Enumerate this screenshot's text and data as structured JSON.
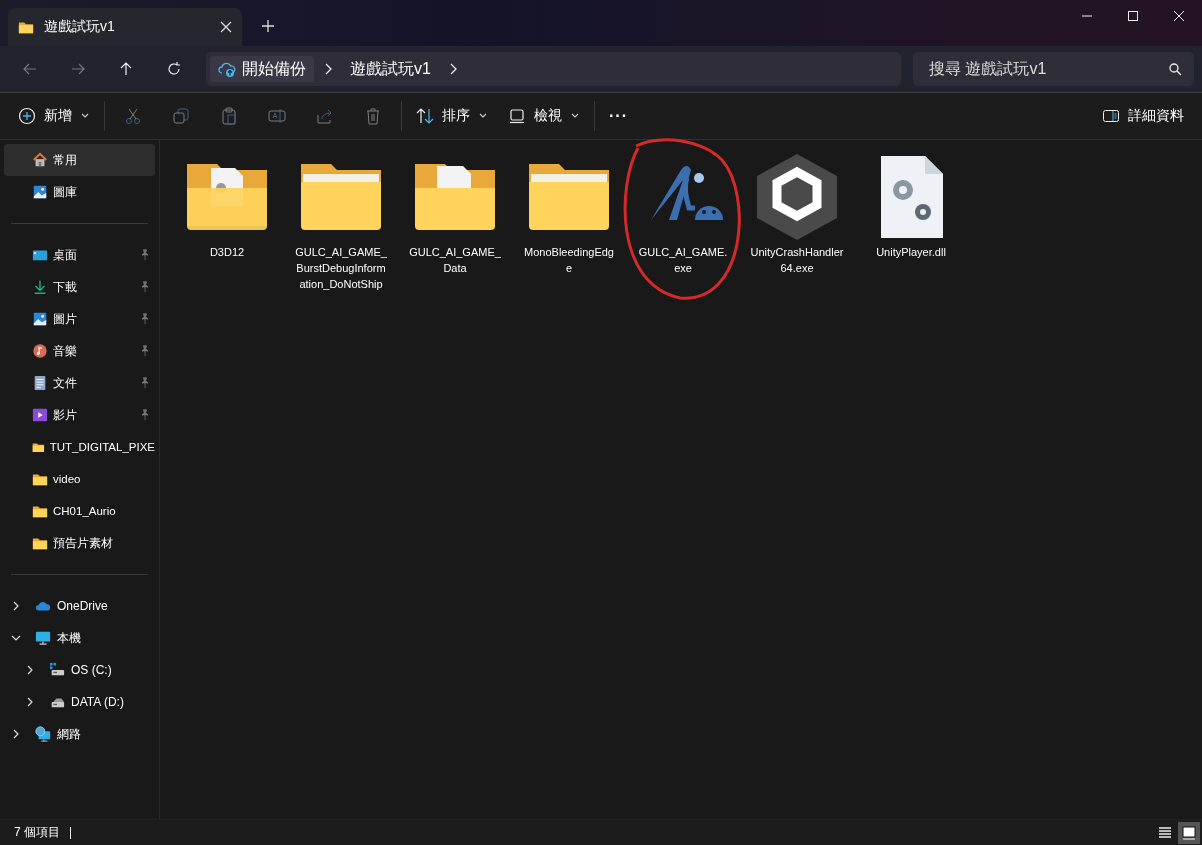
{
  "window": {
    "tab_title": "遊戲試玩v1"
  },
  "nav": {
    "breadcrumbs": [
      "開始備份",
      "遊戲試玩v1"
    ],
    "search": {
      "placeholder": "搜尋 遊戲試玩v1"
    }
  },
  "toolbar": {
    "items": [
      {
        "kind": "menu",
        "label": "新增",
        "disabled": false
      },
      {
        "kind": "icon",
        "disabled": true
      },
      {
        "kind": "icon",
        "disabled": true
      },
      {
        "kind": "icon",
        "disabled": true
      },
      {
        "kind": "icon",
        "disabled": true
      },
      {
        "kind": "icon",
        "disabled": true
      },
      {
        "kind": "icon",
        "disabled": true
      },
      {
        "kind": "menu",
        "label": "排序",
        "disabled": false
      },
      {
        "kind": "menu",
        "label": "檢視",
        "disabled": false
      },
      {
        "kind": "more",
        "label": "···",
        "disabled": false
      }
    ],
    "details": "詳細資料"
  },
  "sidebar": {
    "top": [
      {
        "label": "常用",
        "selected": true
      },
      {
        "label": "圖庫",
        "selected": false
      }
    ],
    "pinned": [
      {
        "label": "桌面",
        "pinned": true
      },
      {
        "label": "下載",
        "pinned": true
      },
      {
        "label": "圖片",
        "pinned": true
      },
      {
        "label": "音樂",
        "pinned": true
      },
      {
        "label": "文件",
        "pinned": true
      },
      {
        "label": "影片",
        "pinned": true
      },
      {
        "label": "TUT_DIGITAL_PIXE",
        "pinned": false
      },
      {
        "label": "video",
        "pinned": false
      },
      {
        "label": "CH01_Aurio",
        "pinned": false
      },
      {
        "label": "預告片素材",
        "pinned": false
      }
    ],
    "tree": [
      {
        "label": "OneDrive",
        "expanded": false
      },
      {
        "label": "本機",
        "expanded": true,
        "children": [
          {
            "label": "OS (C:)",
            "expanded": false
          },
          {
            "label": "DATA (D:)",
            "expanded": false
          }
        ]
      },
      {
        "label": "網路",
        "expanded": false
      }
    ]
  },
  "files": [
    {
      "name": "D3D12",
      "kind": "folder",
      "annotated": false
    },
    {
      "name": "GULC_AI_GAME_BurstDebugInformation_DoNotShip",
      "kind": "folder",
      "annotated": false
    },
    {
      "name": "GULC_AI_GAME_Data",
      "kind": "folder",
      "annotated": false
    },
    {
      "name": "MonoBleedingEdge",
      "kind": "folder",
      "annotated": false
    },
    {
      "name": "GULC_AI_GAME.exe",
      "kind": "application",
      "annotated": true
    },
    {
      "name": "UnityCrashHandler64.exe",
      "kind": "application",
      "annotated": false
    },
    {
      "name": "UnityPlayer.dll",
      "kind": "library",
      "annotated": false
    }
  ],
  "status_bar": {
    "count": "7 個項目",
    "views": [
      {
        "selected": false
      },
      {
        "selected": true
      }
    ]
  }
}
